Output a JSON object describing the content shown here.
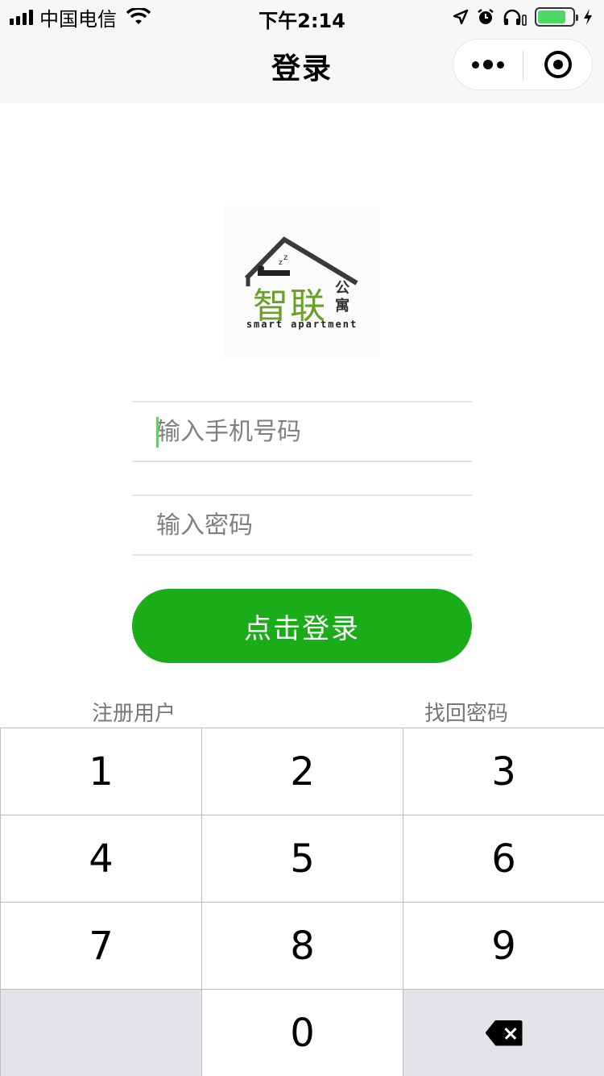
{
  "status_bar": {
    "carrier": "中国电信",
    "time": "下午2:14"
  },
  "nav": {
    "title": "登录"
  },
  "logo": {
    "cn_main": "智联",
    "cn_side": "公寓",
    "en": "smart apartment"
  },
  "form": {
    "phone_placeholder": "输入手机号码",
    "password_placeholder": "输入密码",
    "login_label": "点击登录",
    "register_label": "注册用户",
    "recover_label": "找回密码"
  },
  "keypad": {
    "keys": [
      "1",
      "2",
      "3",
      "4",
      "5",
      "6",
      "7",
      "8",
      "9",
      "",
      "0",
      ""
    ]
  },
  "colors": {
    "accent": "#1aad19",
    "logo_green": "#6aa12b",
    "battery": "#4cd964"
  }
}
